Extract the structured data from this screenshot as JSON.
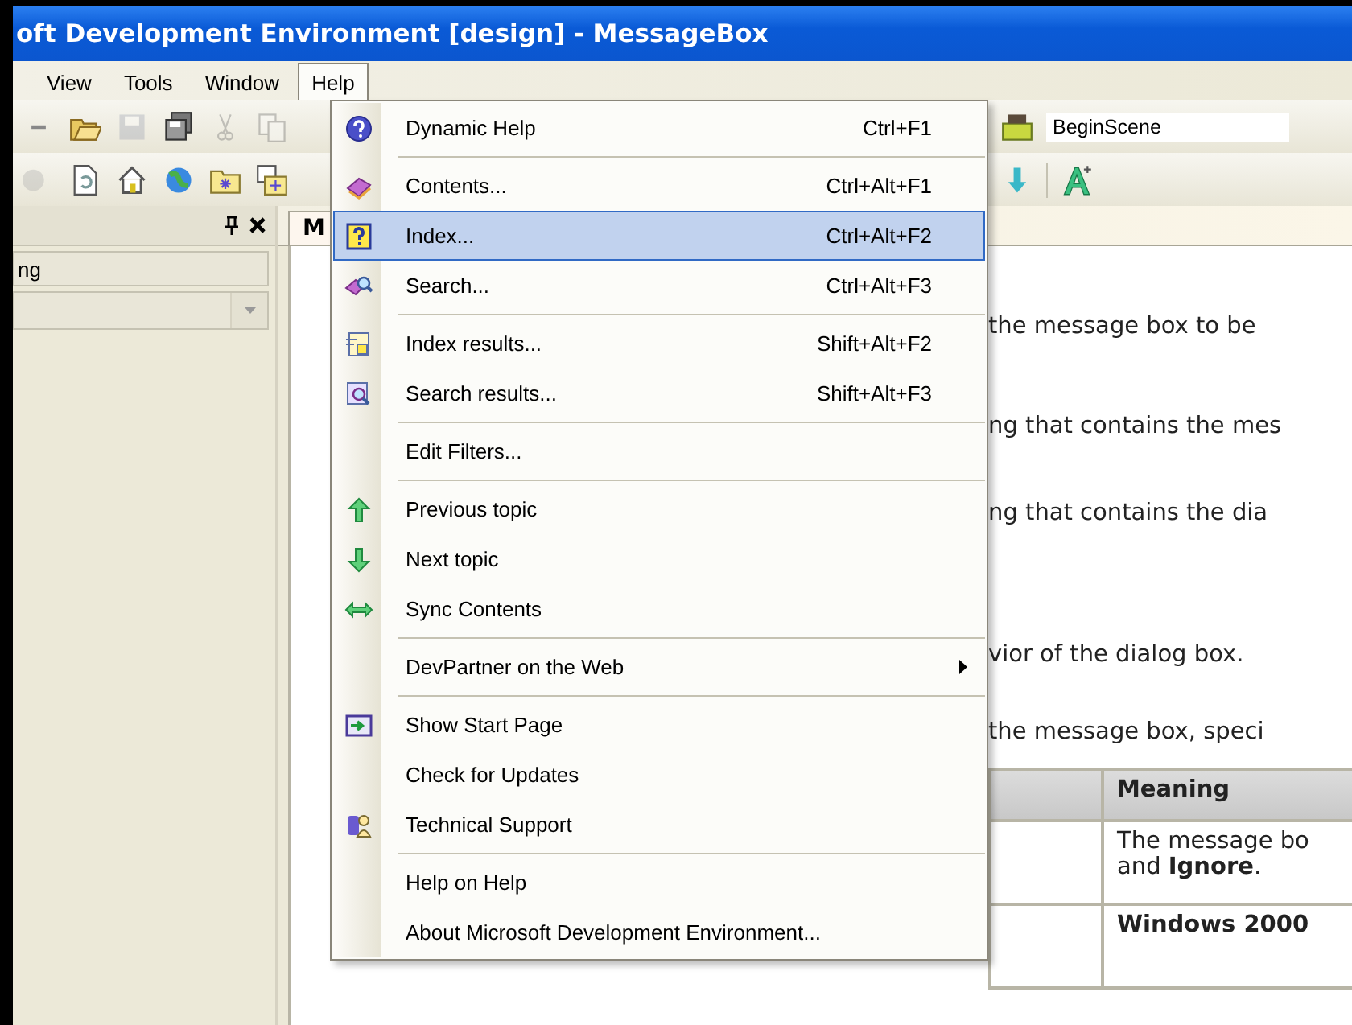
{
  "window": {
    "title": "oft Development Environment [design] - MessageBox"
  },
  "menubar": [
    {
      "label": "View",
      "open": false
    },
    {
      "label": "Tools",
      "open": false
    },
    {
      "label": "Window",
      "open": false
    },
    {
      "label": "Help",
      "open": true
    }
  ],
  "toolbar": {
    "combo_text": "BeginScene"
  },
  "left_panel": {
    "field_text": "ng"
  },
  "document_tab": {
    "label": "M"
  },
  "help_menu": {
    "items": [
      {
        "kind": "item",
        "label": "Dynamic Help",
        "shortcut": "Ctrl+F1",
        "selected": false
      },
      {
        "kind": "separator"
      },
      {
        "kind": "item",
        "label": "Contents...",
        "shortcut": "Ctrl+Alt+F1",
        "selected": false
      },
      {
        "kind": "item",
        "label": "Index...",
        "shortcut": "Ctrl+Alt+F2",
        "selected": true
      },
      {
        "kind": "item",
        "label": "Search...",
        "shortcut": "Ctrl+Alt+F3",
        "selected": false
      },
      {
        "kind": "separator"
      },
      {
        "kind": "item",
        "label": "Index results...",
        "shortcut": "Shift+Alt+F2",
        "selected": false
      },
      {
        "kind": "item",
        "label": "Search results...",
        "shortcut": "Shift+Alt+F3",
        "selected": false
      },
      {
        "kind": "separator"
      },
      {
        "kind": "item",
        "label": "Edit Filters...",
        "selected": false
      },
      {
        "kind": "separator"
      },
      {
        "kind": "item",
        "label": "Previous topic",
        "selected": false
      },
      {
        "kind": "item",
        "label": "Next topic",
        "selected": false
      },
      {
        "kind": "item",
        "label": "Sync Contents",
        "selected": false
      },
      {
        "kind": "separator"
      },
      {
        "kind": "submenu",
        "label": "DevPartner on the Web",
        "selected": false
      },
      {
        "kind": "separator"
      },
      {
        "kind": "item",
        "label": "Show Start Page",
        "selected": false
      },
      {
        "kind": "item",
        "label": "Check for Updates",
        "selected": false
      },
      {
        "kind": "item",
        "label": "Technical Support",
        "selected": false
      },
      {
        "kind": "separator"
      },
      {
        "kind": "item",
        "label": "Help on Help",
        "selected": false
      },
      {
        "kind": "item",
        "label": "About Microsoft Development Environment...",
        "selected": false
      }
    ]
  },
  "document": {
    "lines": [
      "the message box to be",
      "ng that contains the mes",
      "ng that contains the dia",
      "vior of the dialog box.",
      "the message box, speci"
    ],
    "table": {
      "columns": [
        "Meaning"
      ],
      "rows": [
        {
          "lines": [
            "The message bo",
            "and **Ignore**."
          ]
        },
        {
          "lines": [
            "**Windows 2000**"
          ]
        }
      ]
    }
  }
}
